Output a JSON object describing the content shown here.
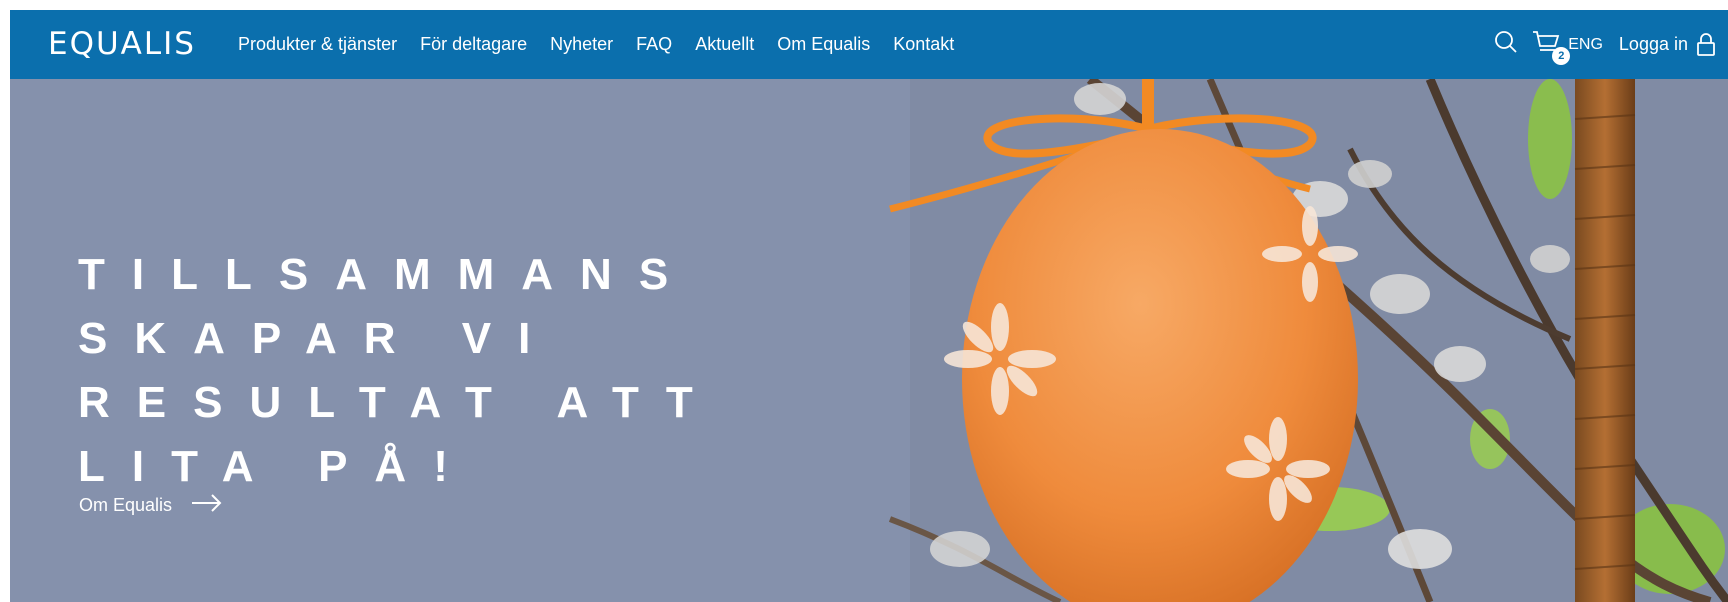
{
  "header": {
    "logo": "EQUALIS",
    "nav": [
      "Produkter & tjänster",
      "För deltagare",
      "Nyheter",
      "FAQ",
      "Aktuellt",
      "Om Equalis",
      "Kontakt"
    ],
    "tools": {
      "search_icon": "search-icon",
      "cart_icon": "cart-icon",
      "cart_count": "2",
      "language": "ENG",
      "login_label": "Logga in",
      "login_icon": "lock-icon"
    },
    "colors": {
      "brand": "#0b6fad"
    }
  },
  "hero": {
    "title_lines": [
      "TILLSAMMANS",
      "SKAPAR VI",
      "RESULTAT ATT",
      "LITA PÅ!"
    ],
    "link_label": "Om Equalis",
    "link_icon": "arrow-right-icon",
    "image": "orange-easter-egg-on-branches"
  }
}
